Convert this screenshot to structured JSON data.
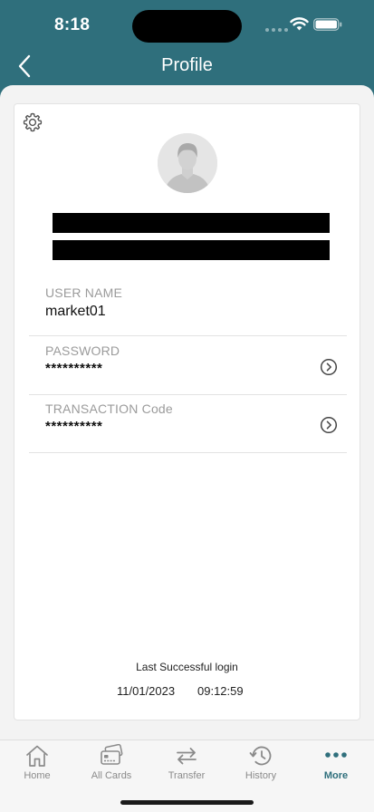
{
  "status_bar": {
    "time": "8:18"
  },
  "header": {
    "title": "Profile"
  },
  "profile": {
    "fields": [
      {
        "label": "USER NAME",
        "value": "market01"
      },
      {
        "label": "PASSWORD",
        "value": "**********"
      },
      {
        "label": "TRANSACTION Code",
        "value": "**********"
      }
    ],
    "last_login": {
      "label": "Last Successful login",
      "date": "11/01/2023",
      "time": "09:12:59"
    }
  },
  "tabbar": {
    "items": [
      {
        "label": "Home",
        "icon": "home-icon"
      },
      {
        "label": "All Cards",
        "icon": "cards-icon"
      },
      {
        "label": "Transfer",
        "icon": "transfer-icon"
      },
      {
        "label": "History",
        "icon": "history-icon"
      },
      {
        "label": "More",
        "icon": "more-icon"
      }
    ],
    "active_index": 4
  },
  "colors": {
    "brand": "#2f6f7c",
    "background": "#f3f3f3"
  }
}
